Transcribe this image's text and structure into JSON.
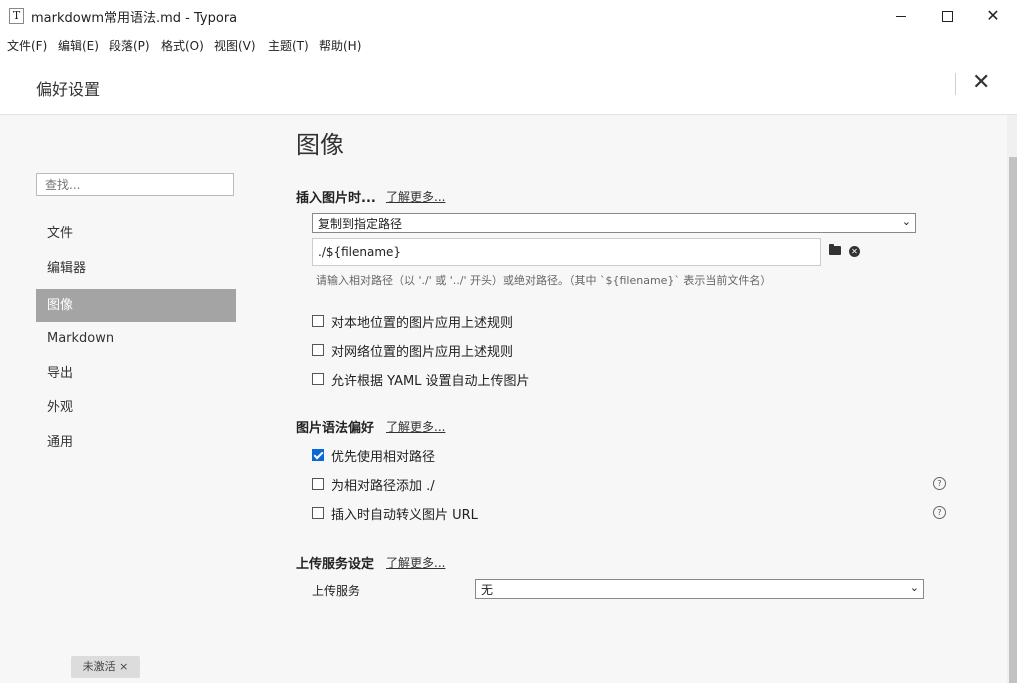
{
  "window": {
    "app_icon": "T",
    "title": "markdowm常用语法.md - Typora",
    "minimize": "minimize-icon",
    "maximize": "maximize-icon",
    "close": "close-icon",
    "close_glyph": "✕"
  },
  "menubar": [
    "文件(F)",
    "编辑(E)",
    "段落(P)",
    "格式(O)",
    "视图(V)",
    "主题(T)",
    "帮助(H)"
  ],
  "prefs": {
    "title": "偏好设置",
    "close_glyph": "✕"
  },
  "sidebar": {
    "search_placeholder": "查找...",
    "items": [
      {
        "label": "文件",
        "active": false
      },
      {
        "label": "编辑器",
        "active": false
      },
      {
        "label": "图像",
        "active": true
      },
      {
        "label": "Markdown",
        "active": false
      },
      {
        "label": "导出",
        "active": false
      },
      {
        "label": "外观",
        "active": false
      },
      {
        "label": "通用",
        "active": false
      }
    ]
  },
  "main": {
    "heading": "图像",
    "insert": {
      "title": "插入图片时...",
      "learn_more": "了解更多...",
      "select_value": "复制到指定路径",
      "path_value": "./${filename}",
      "hint": "请输入相对路径（以 './' 或 '../' 开头）或绝对路径。（其中 `${filename}` 表示当前文件名）",
      "options": [
        {
          "label": "对本地位置的图片应用上述规则",
          "checked": false
        },
        {
          "label": "对网络位置的图片应用上述规则",
          "checked": false
        },
        {
          "label": "允许根据 YAML 设置自动上传图片",
          "checked": false
        }
      ]
    },
    "syntax": {
      "title": "图片语法偏好",
      "learn_more": "了解更多...",
      "options": [
        {
          "label": "优先使用相对路径",
          "checked": true
        },
        {
          "label": "为相对路径添加 ./",
          "checked": false
        },
        {
          "label": "插入时自动转义图片 URL",
          "checked": false
        }
      ]
    },
    "upload": {
      "title": "上传服务设定",
      "learn_more": "了解更多...",
      "label": "上传服务",
      "select_value": "无"
    }
  },
  "badge": "未激活 ×",
  "colors": {
    "accent": "#0b66d6",
    "active_nav": "#a4a4a4",
    "panel_bg": "#f7f7f7"
  }
}
